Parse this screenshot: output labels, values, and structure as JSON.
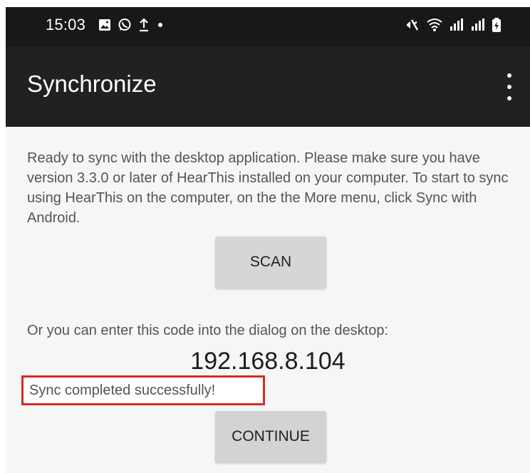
{
  "status_bar": {
    "time": "15:03",
    "icons_left": [
      "gallery-icon",
      "whatsapp-icon",
      "upload-icon",
      "dot-icon"
    ],
    "icons_right": [
      "mute-icon",
      "wifi-icon",
      "signal-icon",
      "signal-icon",
      "battery-icon"
    ]
  },
  "app_bar": {
    "title": "Synchronize",
    "menu_icon": "more-vertical-icon"
  },
  "main": {
    "instructions": "Ready to sync with the desktop application. Please make sure you have version 3.3.0 or later of HearThis installed on your computer. To start to sync using HearThis on the computer, on the the More menu, click Sync with Android.",
    "scan_label": "SCAN",
    "code_hint": "Or you can enter this code into the dialog on the desktop:",
    "ip_code": "192.168.8.104",
    "status_message": "Sync completed successfully!",
    "continue_label": "CONTINUE"
  },
  "colors": {
    "status_bar": "#181818",
    "app_bar": "#212121",
    "button": "#d6d6d6",
    "highlight": "#d62a2a"
  }
}
